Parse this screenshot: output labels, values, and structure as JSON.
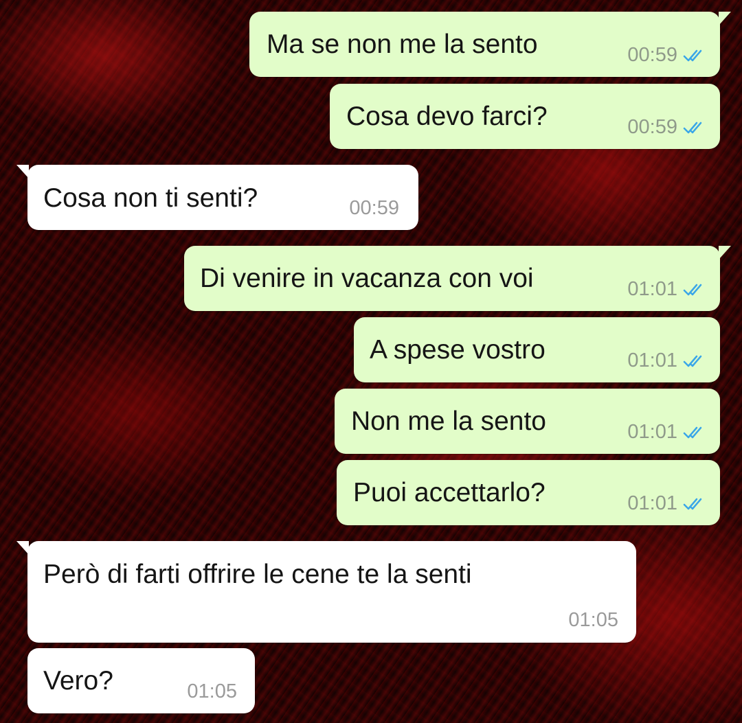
{
  "colors": {
    "outgoing_bubble": "#e2fdc9",
    "incoming_bubble": "#ffffff",
    "read_ticks": "#3aa6e8",
    "timestamp": "#9a9a9a"
  },
  "messages": [
    {
      "direction": "outgoing",
      "text": "Ma se non me la sento",
      "time": "00:59",
      "status": "read"
    },
    {
      "direction": "outgoing",
      "text": "Cosa devo farci?",
      "time": "00:59",
      "status": "read"
    },
    {
      "direction": "incoming",
      "text": "Cosa non ti senti?",
      "time": "00:59"
    },
    {
      "direction": "outgoing",
      "text": "Di venire in vacanza con voi",
      "time": "01:01",
      "status": "read"
    },
    {
      "direction": "outgoing",
      "text": "A spese vostro",
      "time": "01:01",
      "status": "read"
    },
    {
      "direction": "outgoing",
      "text": "Non me la sento",
      "time": "01:01",
      "status": "read"
    },
    {
      "direction": "outgoing",
      "text": "Puoi accettarlo?",
      "time": "01:01",
      "status": "read"
    },
    {
      "direction": "incoming",
      "text": "Però di farti offrire le cene te la senti",
      "time": "01:05"
    },
    {
      "direction": "incoming",
      "text": "Vero?",
      "time": "01:05"
    }
  ],
  "icons": {
    "read_status": "double-check-icon"
  }
}
